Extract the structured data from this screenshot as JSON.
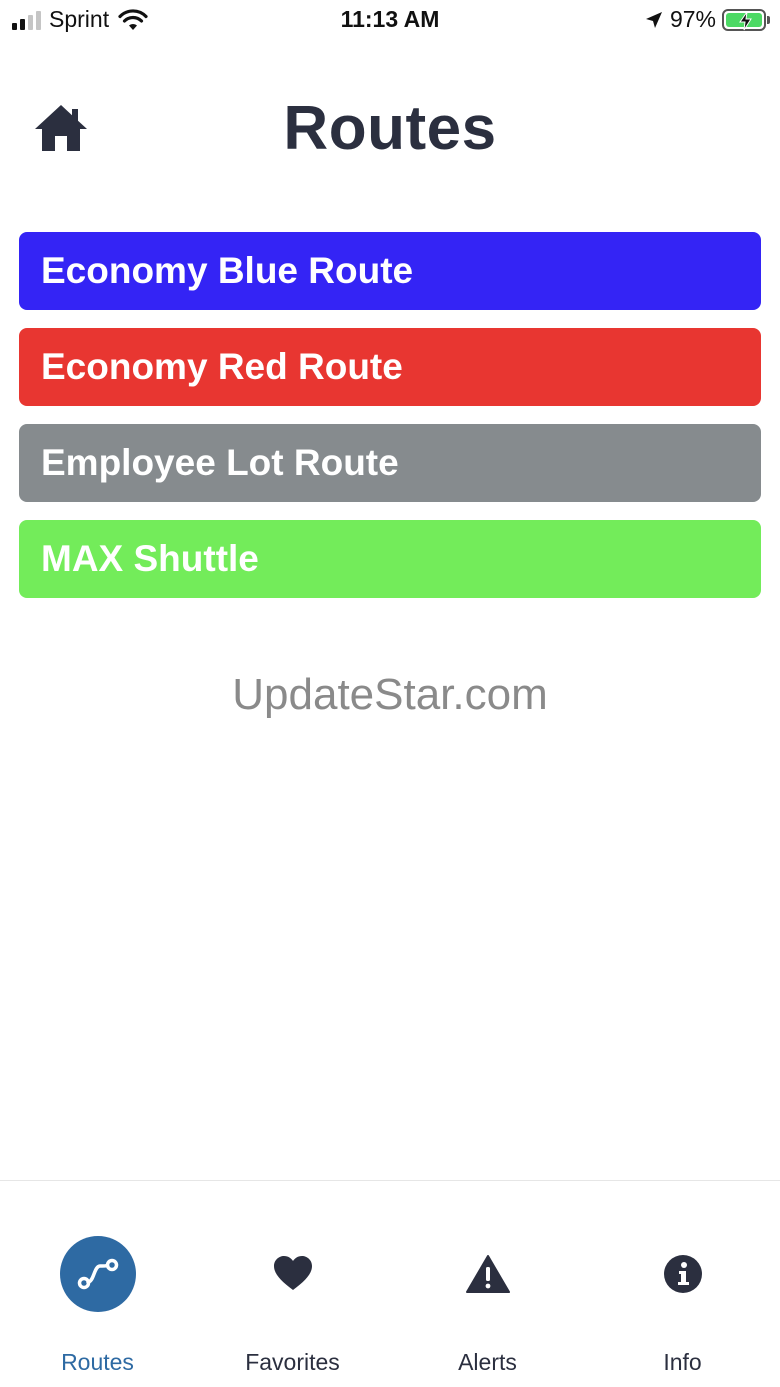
{
  "status_bar": {
    "carrier": "Sprint",
    "time": "11:13 AM",
    "battery_percent": "97%",
    "icons": [
      "signal-icon",
      "wifi-icon",
      "location-arrow-icon",
      "battery-charging-icon"
    ]
  },
  "header": {
    "title": "Routes",
    "home_icon": "home-icon"
  },
  "routes": [
    {
      "label": "Economy Blue Route",
      "color": "#3424f5"
    },
    {
      "label": "Economy Red Route",
      "color": "#e83631"
    },
    {
      "label": "Employee Lot Route",
      "color": "#868b8e"
    },
    {
      "label": "MAX Shuttle",
      "color": "#73ec5a"
    }
  ],
  "watermark": "UpdateStar.com",
  "tab_bar": {
    "accent_color": "#2e6aa3",
    "tabs": [
      {
        "label": "Routes",
        "icon": "route-icon",
        "active": true
      },
      {
        "label": "Favorites",
        "icon": "heart-icon",
        "active": false
      },
      {
        "label": "Alerts",
        "icon": "warning-icon",
        "active": false
      },
      {
        "label": "Info",
        "icon": "info-icon",
        "active": false
      }
    ]
  }
}
